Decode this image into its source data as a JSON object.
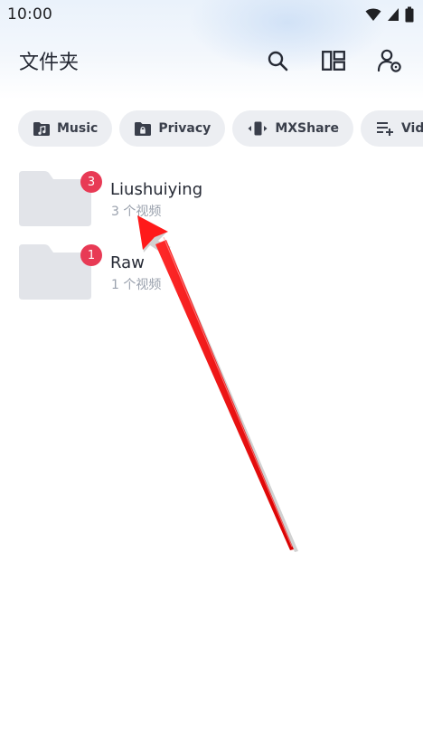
{
  "status_bar": {
    "time": "10:00",
    "icons": [
      "wifi-icon",
      "signal-icon",
      "battery-icon"
    ]
  },
  "app_bar": {
    "title": "文件夹",
    "actions": [
      "search-icon",
      "layout-icon",
      "account-settings-icon"
    ]
  },
  "chips": [
    {
      "label": "Music",
      "icon": "music-folder-icon"
    },
    {
      "label": "Privacy",
      "icon": "lock-folder-icon"
    },
    {
      "label": "MXShare",
      "icon": "share-transfer-icon"
    },
    {
      "label": "Video P",
      "icon": "playlist-add-icon"
    }
  ],
  "folders": [
    {
      "name": "Liushuiying",
      "count": "3 个视频",
      "badge": "3"
    },
    {
      "name": "Raw",
      "count": "1 个视频",
      "badge": "1"
    }
  ],
  "colors": {
    "badge": "#e83a55",
    "chip_bg": "#eceef2",
    "folder": "#e2e4e9",
    "annotation_arrow": "#ff0000"
  }
}
